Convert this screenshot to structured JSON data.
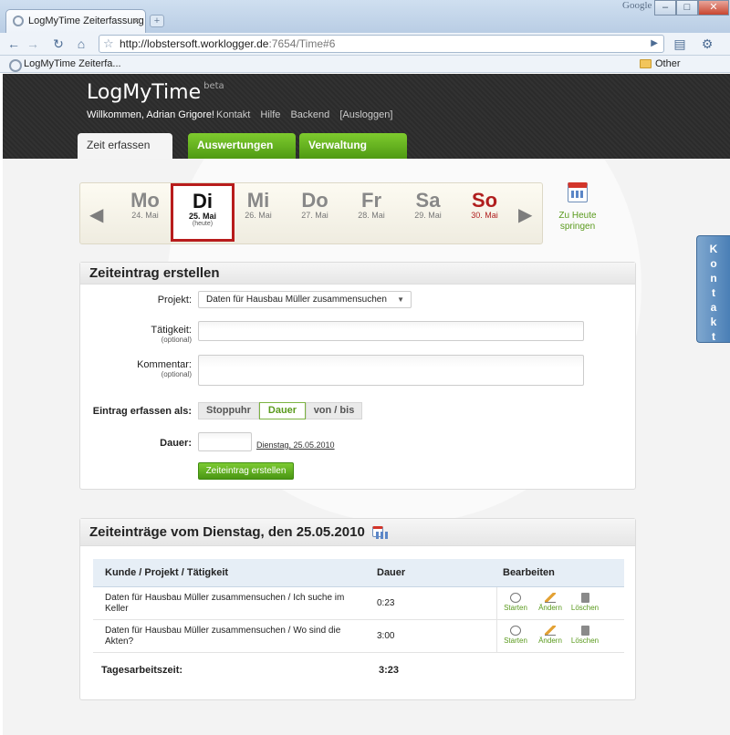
{
  "browser": {
    "tab_title": "LogMyTime Zeiterfassung",
    "brand": "Google",
    "url_host": "http://lobstersoft.worklogger.de",
    "url_rest": ":7654/Time#6",
    "bookmark": "LogMyTime Zeiterfa...",
    "other_bookmarks": "Other bookmarks"
  },
  "header": {
    "logo": "LogMyTime",
    "logo_badge": "beta",
    "welcome": "Willkommen, Adrian Grigore!",
    "links": [
      "Kontakt",
      "Hilfe",
      "Backend",
      "[Ausloggen]"
    ],
    "tabs": [
      "Zeit erfassen",
      "Auswertungen",
      "Verwaltung"
    ]
  },
  "date_strip": {
    "days": [
      {
        "name": "Mo",
        "date": "24. Mai"
      },
      {
        "name": "Di",
        "date": "25. Mai",
        "sub": "(heute)"
      },
      {
        "name": "Mi",
        "date": "26. Mai"
      },
      {
        "name": "Do",
        "date": "27. Mai"
      },
      {
        "name": "Fr",
        "date": "28. Mai"
      },
      {
        "name": "Sa",
        "date": "29. Mai"
      },
      {
        "name": "So",
        "date": "30. Mai"
      }
    ],
    "today_link": "Zu Heute springen"
  },
  "form": {
    "title": "Zeiteintrag erstellen",
    "project_label": "Projekt:",
    "project_value": "Daten für Hausbau Müller zusammensuchen",
    "activity_label": "Tätigkeit:",
    "optional": "(optional)",
    "comment_label": "Kommentar:",
    "mode_label": "Eintrag erfassen als:",
    "modes": [
      "Stoppuhr",
      "Dauer",
      "von / bis"
    ],
    "duration_label": "Dauer:",
    "date_link": "Dienstag, 25.05.2010",
    "submit": "Zeiteintrag erstellen"
  },
  "entries": {
    "title": "Zeiteinträge vom Dienstag, den 25.05.2010",
    "columns": [
      "Kunde / Projekt / Tätigkeit",
      "Dauer",
      "Bearbeiten"
    ],
    "rows": [
      {
        "text": "Daten für Hausbau Müller zusammensuchen / Ich suche im Keller",
        "duration": "0:23"
      },
      {
        "text": "Daten für Hausbau Müller zusammensuchen / Wo sind die Akten?",
        "duration": "3:00"
      }
    ],
    "actions": [
      "Starten",
      "Ändern",
      "Löschen"
    ],
    "total_label": "Tagesarbeitszeit:",
    "total_value": "3:23"
  },
  "side_tab": "Kontakt",
  "colors": {
    "accent_green": "#5a9a1d",
    "today_border": "#b81c1c",
    "sunday_red": "#b01e1e"
  }
}
